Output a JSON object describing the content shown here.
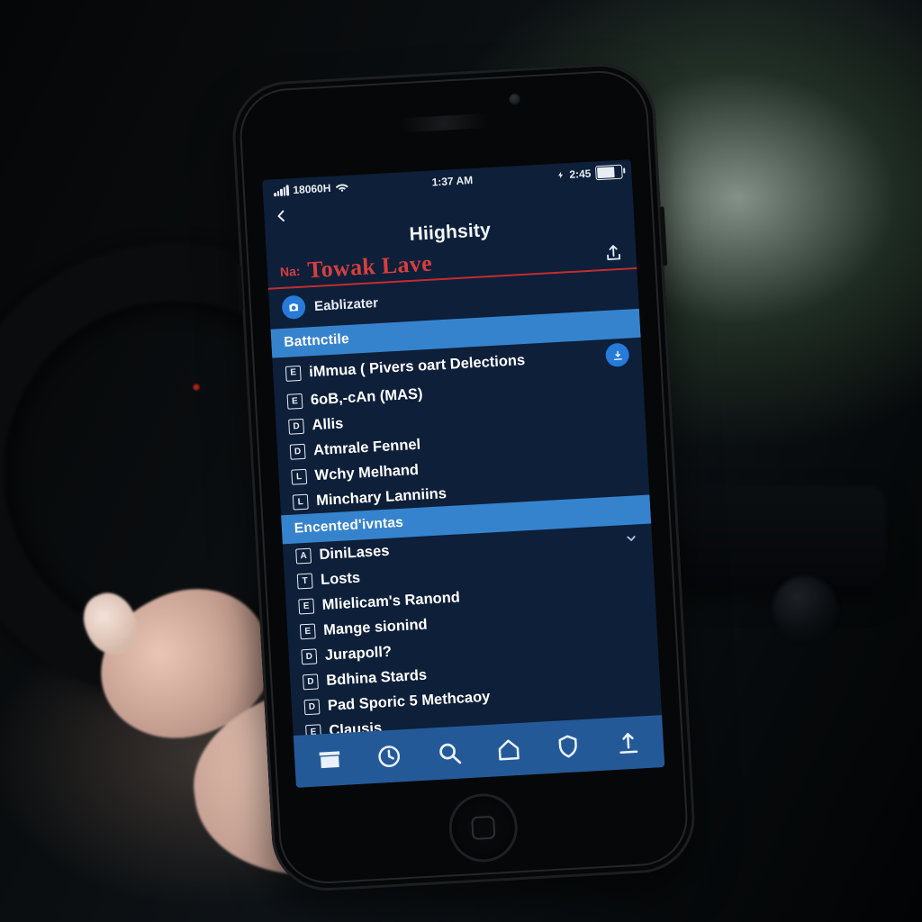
{
  "colors": {
    "bg": "#0b1f3c",
    "section": "#2f84d6",
    "footer": "#1f5aa0",
    "accent_blue": "#1e7be6",
    "accent_red": "#e23b3b"
  },
  "statusbar": {
    "carrier_text": "18060H",
    "clock_inner": "1:37 AM",
    "clock_outer": "2:45",
    "battery_pct": 72
  },
  "header": {
    "title": "Hiighsity",
    "sub_prefix": "Na:",
    "sub_main": "Towak Lave",
    "subtitle": "Eablizater"
  },
  "sections": [
    {
      "title": "Battnctile",
      "items": [
        {
          "badge": "E",
          "label": "iMmua ( Pivers oart Delections",
          "action": "download"
        },
        {
          "badge": "E",
          "label": "6oB,-cAn (MAS)"
        },
        {
          "badge": "D",
          "label": "Allis"
        },
        {
          "badge": "D",
          "label": "Atmrale Fennel"
        },
        {
          "badge": "L",
          "label": "Wchy Melhand"
        },
        {
          "badge": "L",
          "label": "Minchary Lanniins"
        }
      ]
    },
    {
      "title": "Encented'ivntas",
      "items": [
        {
          "badge": "A",
          "label": "DiniLases",
          "action": "chevron"
        },
        {
          "badge": "T",
          "label": "Losts"
        },
        {
          "badge": "E",
          "label": "Mlielicam's Ranond"
        },
        {
          "badge": "E",
          "label": "Mange sionind"
        },
        {
          "badge": "D",
          "label": "Jurapoll?"
        },
        {
          "badge": "D",
          "label": "Bdhina Stards"
        },
        {
          "badge": "D",
          "label": "Pad Sporic 5 Methcaoy"
        },
        {
          "badge": "E",
          "label": "Clausis"
        }
      ]
    }
  ],
  "footer_icons": [
    "archive-icon",
    "clock-icon",
    "search-icon",
    "home-icon",
    "shield-icon",
    "upload-icon"
  ]
}
